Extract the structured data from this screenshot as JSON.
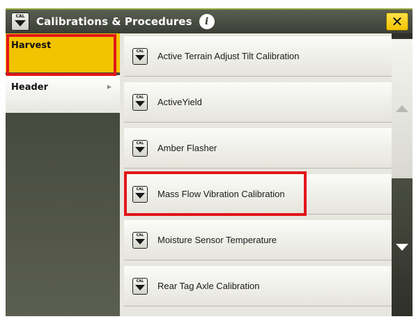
{
  "window": {
    "title": "Calibrations & Procedures",
    "badge_text": "CAL",
    "close_symbol": "✕",
    "info_symbol": "i"
  },
  "left_menu": {
    "items": [
      {
        "label": "Harvest",
        "selected": true,
        "has_chevron": false
      },
      {
        "label": "Header",
        "selected": false,
        "has_chevron": true
      }
    ],
    "chevron_symbol": "▶"
  },
  "procedures": {
    "icon_text": "CAL",
    "items": [
      {
        "label": "Active Terrain Adjust Tilt Calibration"
      },
      {
        "label": "ActiveYield"
      },
      {
        "label": "Amber Flasher"
      },
      {
        "label": "Mass Flow Vibration Calibration",
        "highlighted": true
      },
      {
        "label": "Moisture Sensor Temperature"
      },
      {
        "label": "Rear Tag Axle Calibration"
      }
    ]
  },
  "colors": {
    "accent_yellow": "#f2c300",
    "highlight_red": "#e3161b",
    "titlebar": "#3b3e35"
  },
  "icons": {
    "cal": "cal-download-icon",
    "info": "info-icon",
    "close": "close-icon",
    "scroll_up": "triangle-up-icon",
    "scroll_down": "triangle-down-icon"
  }
}
